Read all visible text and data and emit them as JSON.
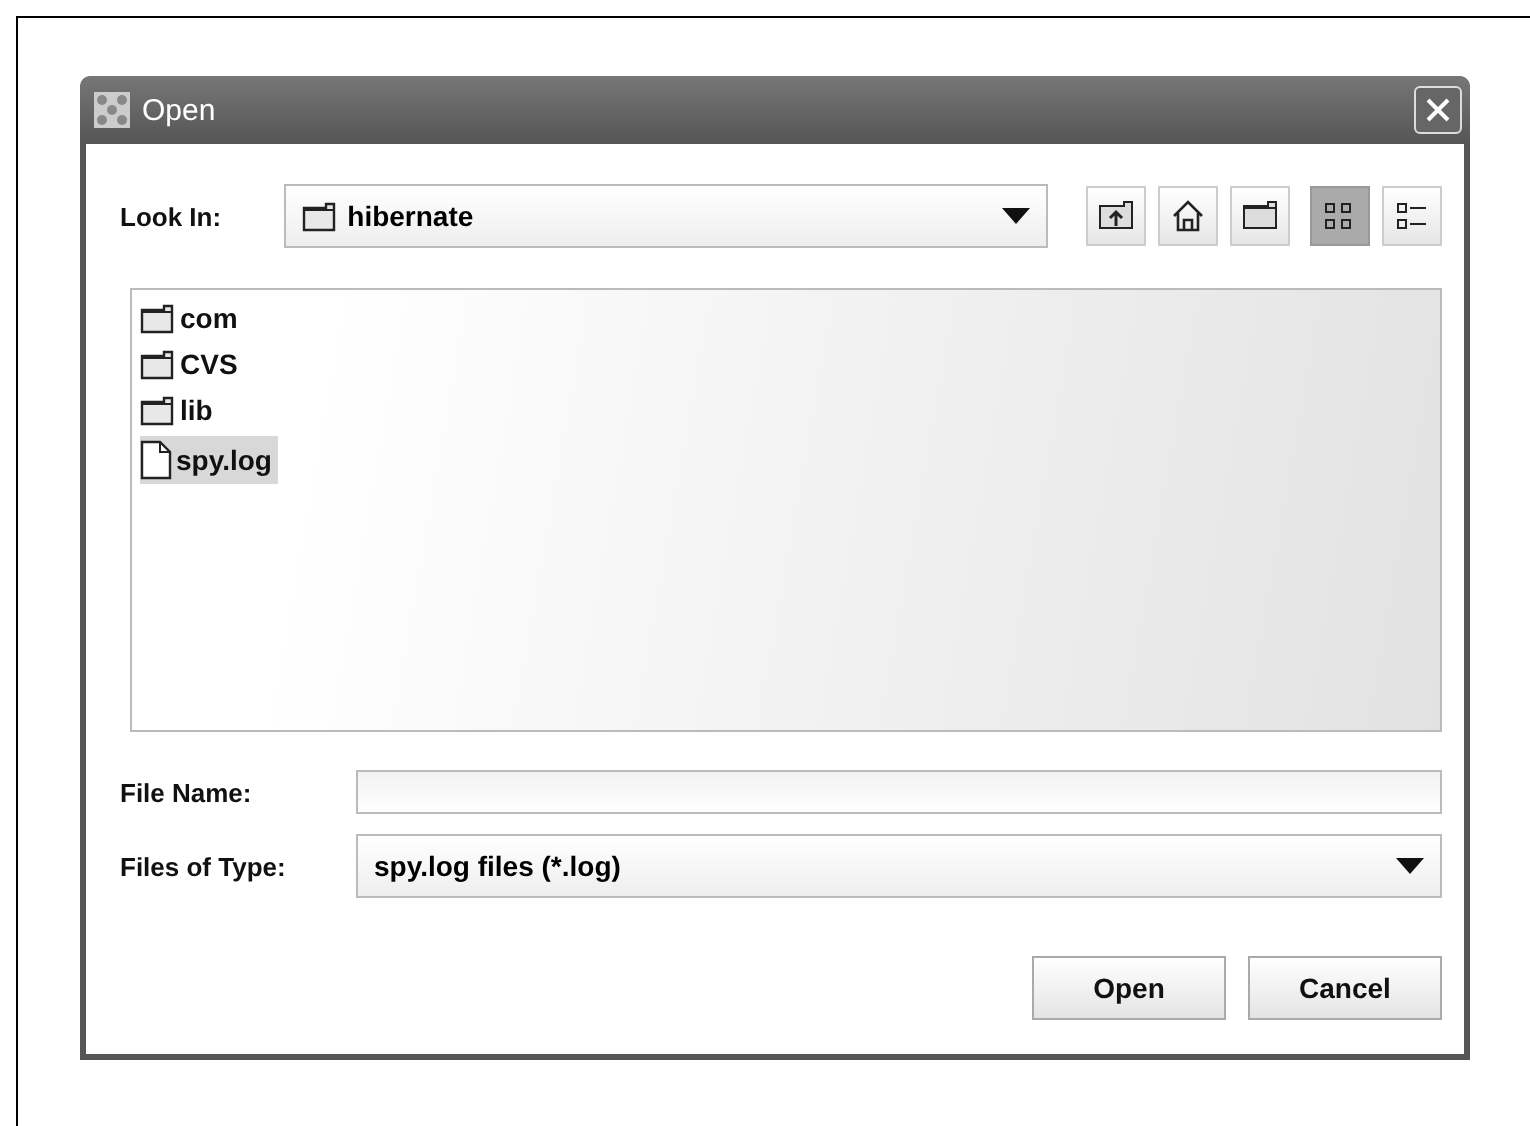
{
  "window": {
    "title": "Open"
  },
  "look_in": {
    "label": "Look In:",
    "value": "hibernate"
  },
  "toolbar": [
    {
      "kind": "up",
      "selected": false
    },
    {
      "kind": "home",
      "selected": false
    },
    {
      "kind": "newfolder",
      "selected": false
    },
    {
      "kind": "list",
      "selected": true
    },
    {
      "kind": "details",
      "selected": false
    }
  ],
  "files": [
    {
      "name": "com",
      "kind": "folder",
      "selected": false
    },
    {
      "name": "CVS",
      "kind": "folder",
      "selected": false
    },
    {
      "name": "lib",
      "kind": "folder",
      "selected": false
    },
    {
      "name": "spy.log",
      "kind": "file",
      "selected": true
    }
  ],
  "file_name": {
    "label": "File Name:"
  },
  "file_type": {
    "label": "Files of Type:",
    "value": "spy.log files (*.log)"
  },
  "buttons": [
    "Open",
    "Cancel"
  ]
}
